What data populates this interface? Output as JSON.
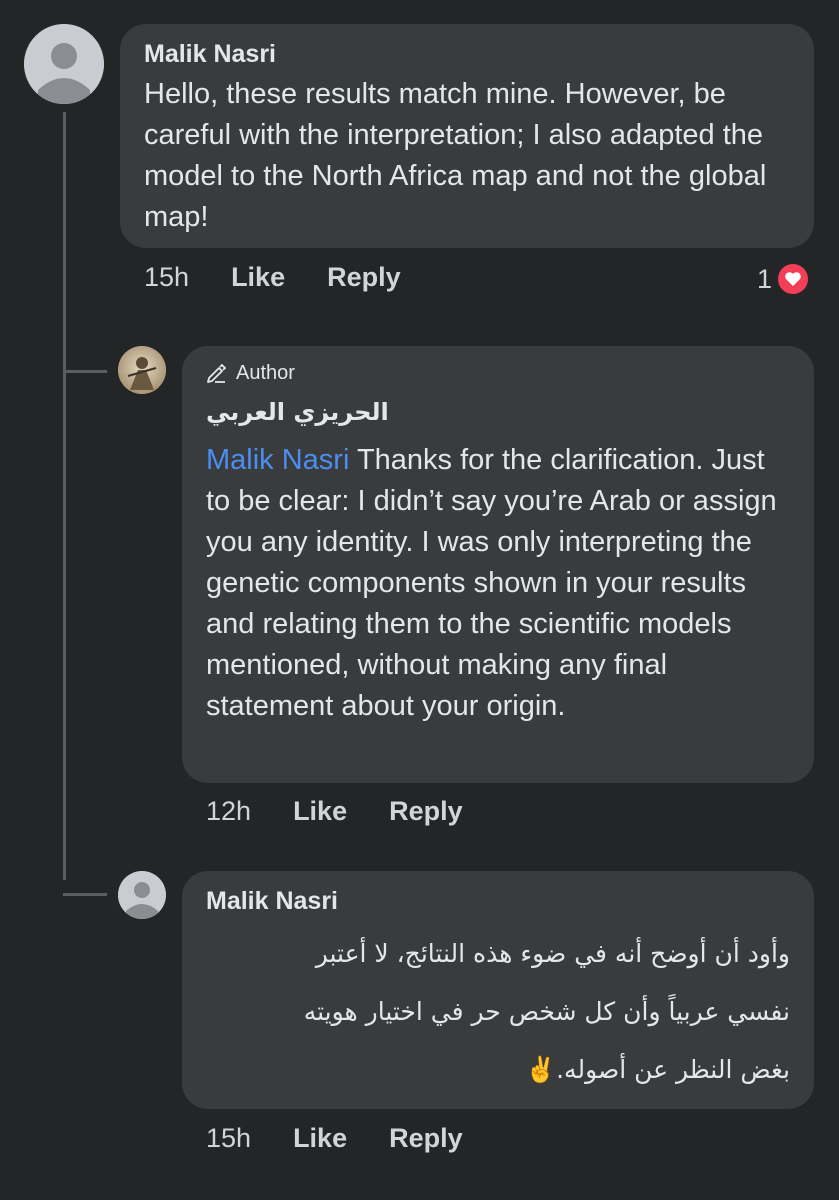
{
  "comments": [
    {
      "author": "Malik Nasri",
      "text": "Hello, these results match mine. However, be careful with the interpretation; I also adapted the model to the North Africa map and not the global map!",
      "time": "15h",
      "like_label": "Like",
      "reply_label": "Reply",
      "reaction_count": "1",
      "reaction_icon": "heart-reaction-icon"
    }
  ],
  "replies": [
    {
      "badge": "Author",
      "author": "الحريزي العربي",
      "mention": "Malik Nasri",
      "text": " Thanks for the clarification. Just to be clear: I didn’t say you’re Arab or assign you any identity. I was only interpreting the genetic components shown in your results and relating them to the scientific models mentioned, without making any final statement about your origin.",
      "time": "12h",
      "like_label": "Like",
      "reply_label": "Reply"
    },
    {
      "author": "Malik Nasri",
      "lines": [
        "وأود أن أوضح أنه في ضوء هذه النتائج، لا أعتبر",
        "نفسي عربياً وأن كل شخص حر في اختيار هويته",
        "بغض النظر عن أصوله.✌️"
      ],
      "time": "15h",
      "like_label": "Like",
      "reply_label": "Reply"
    }
  ],
  "colors": {
    "background": "#242526",
    "bubble": "#3a3b3c",
    "text": "#e4e6eb",
    "mention": "#4b8ef1",
    "heart": "#f33e58"
  }
}
